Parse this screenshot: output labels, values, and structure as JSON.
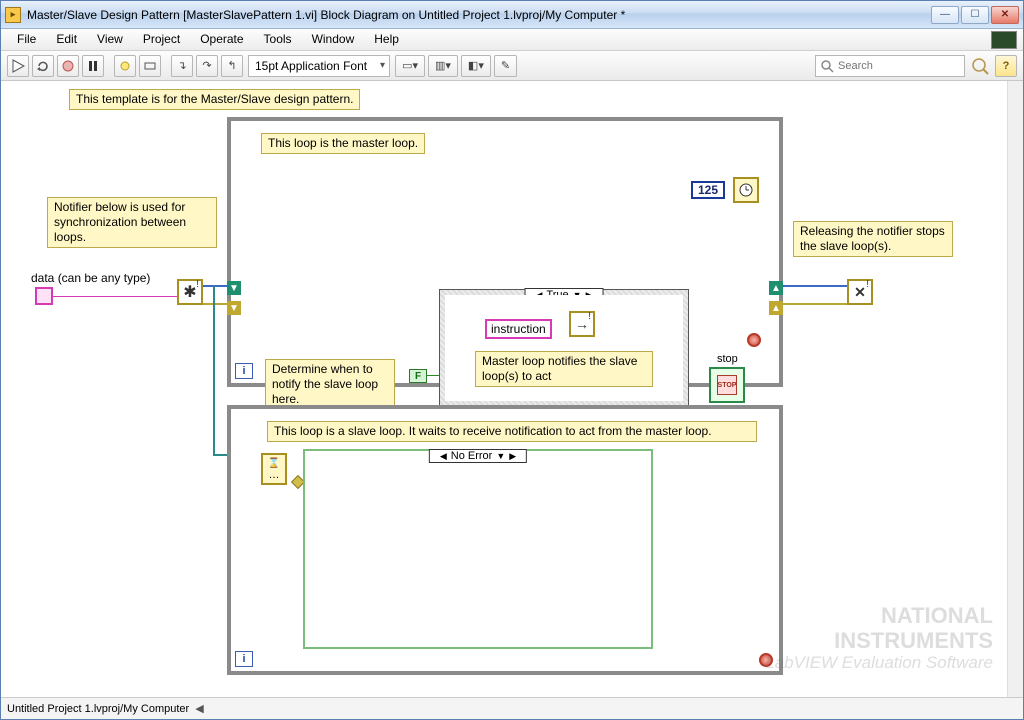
{
  "window": {
    "title": "Master/Slave Design Pattern [MasterSlavePattern 1.vi] Block Diagram on Untitled Project 1.lvproj/My Computer *"
  },
  "menus": {
    "file": "File",
    "edit": "Edit",
    "view": "View",
    "project": "Project",
    "operate": "Operate",
    "tools": "Tools",
    "window": "Window",
    "help": "Help"
  },
  "toolbar": {
    "font_label": "15pt Application Font",
    "search_placeholder": "Search"
  },
  "notes": {
    "template": "This template is for the Master/Slave design pattern.",
    "master_header": "This loop is the master loop.",
    "notifier_info": "Notifier below is used for synchronization between loops.",
    "data_label": "data (can be any type)",
    "determine": "Determine when to notify the slave loop here.",
    "case_true": "True",
    "instruction": "instruction",
    "master_notifies": "Master loop notifies the slave loop(s) to act",
    "stop_label": "stop",
    "release": "Releasing the notifier stops the slave loop(s).",
    "slave_header": "This loop is a slave loop. It waits to receive notification to act from the master loop.",
    "no_error": "No Error",
    "const125": "125",
    "boolF": "F",
    "stop_btn": "STOP"
  },
  "status": {
    "path": "Untitled Project 1.lvproj/My Computer"
  },
  "watermark": {
    "line1": "NATIONAL",
    "line2": "INSTRUMENTS",
    "line3": "LabVIEW Evaluation Software"
  }
}
